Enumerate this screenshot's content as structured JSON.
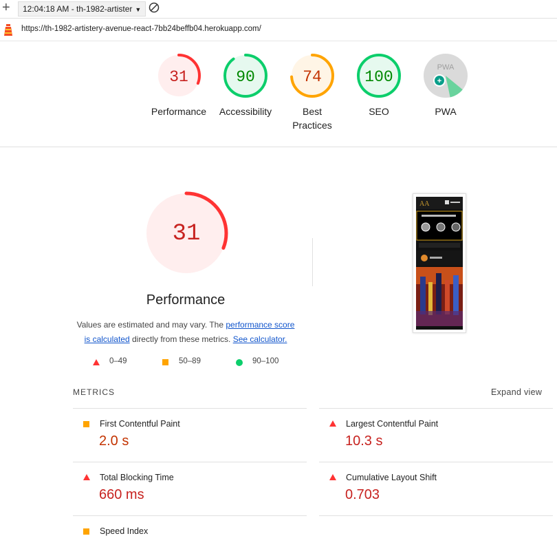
{
  "toolbar": {
    "add_icon": "plus-icon",
    "report_label": "12:04:18 AM - th-1982-artister",
    "block_icon": "block-icon"
  },
  "urlbar": {
    "url": "https://th-1982-artistery-avenue-react-7bb24beffb04.herokuapp.com/"
  },
  "colors": {
    "fail": "#ff3333",
    "fail_text": "#c7221f",
    "average": "#ffa400",
    "average_text": "#c33300",
    "pass": "#0cce6b",
    "pass_text": "#008800"
  },
  "scores": [
    {
      "value": "31",
      "label": "Performance",
      "fraction": 0.31,
      "status": "fail"
    },
    {
      "value": "90",
      "label": "Accessibility",
      "fraction": 0.9,
      "status": "pass"
    },
    {
      "value": "74",
      "label": "Best",
      "label2": "Practices",
      "fraction": 0.74,
      "status": "average"
    },
    {
      "value": "100",
      "label": "SEO",
      "fraction": 1.0,
      "status": "pass"
    },
    {
      "value": "PWA",
      "label": "PWA",
      "status": "pwa"
    }
  ],
  "performance": {
    "score": "31",
    "fraction": 0.31,
    "title": "Performance",
    "desc_1": "Values are estimated and may vary. The ",
    "desc_link1": "performance score",
    "desc_link2": "is calculated",
    "desc_2": " directly from these metrics. ",
    "desc_link3": "See calculator."
  },
  "legend": {
    "fail": "0–49",
    "average": "50–89",
    "pass": "90–100"
  },
  "metrics": {
    "header": "METRICS",
    "expand": "Expand view",
    "items": [
      {
        "name": "First Contentful Paint",
        "value": "2.0 s",
        "status": "average"
      },
      {
        "name": "Largest Contentful Paint",
        "value": "10.3 s",
        "status": "fail"
      },
      {
        "name": "Total Blocking Time",
        "value": "660 ms",
        "status": "fail"
      },
      {
        "name": "Cumulative Layout Shift",
        "value": "0.703",
        "status": "fail"
      },
      {
        "name": "Speed Index",
        "value": "",
        "status": "average"
      }
    ]
  }
}
